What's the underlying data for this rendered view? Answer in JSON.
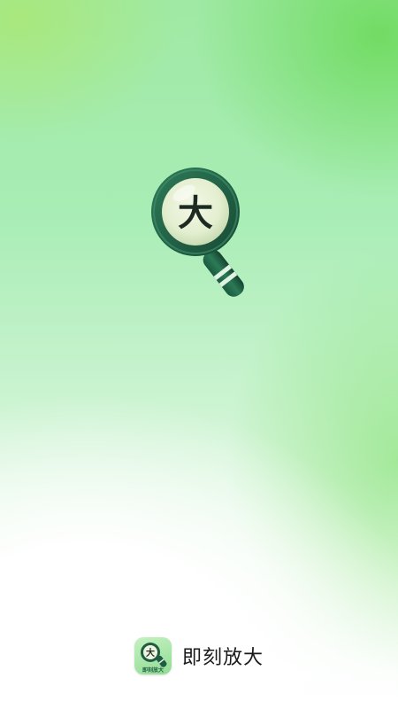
{
  "splash": {
    "logo_glyph": "大",
    "app_icon_glyph": "大",
    "app_icon_caption": "即刻放大",
    "app_name": "即刻放大",
    "colors": {
      "ring": "#1f5c42",
      "lens": "#e6f0d4",
      "glyph": "#1d2a22",
      "handle_band": "#dff3e3"
    }
  }
}
